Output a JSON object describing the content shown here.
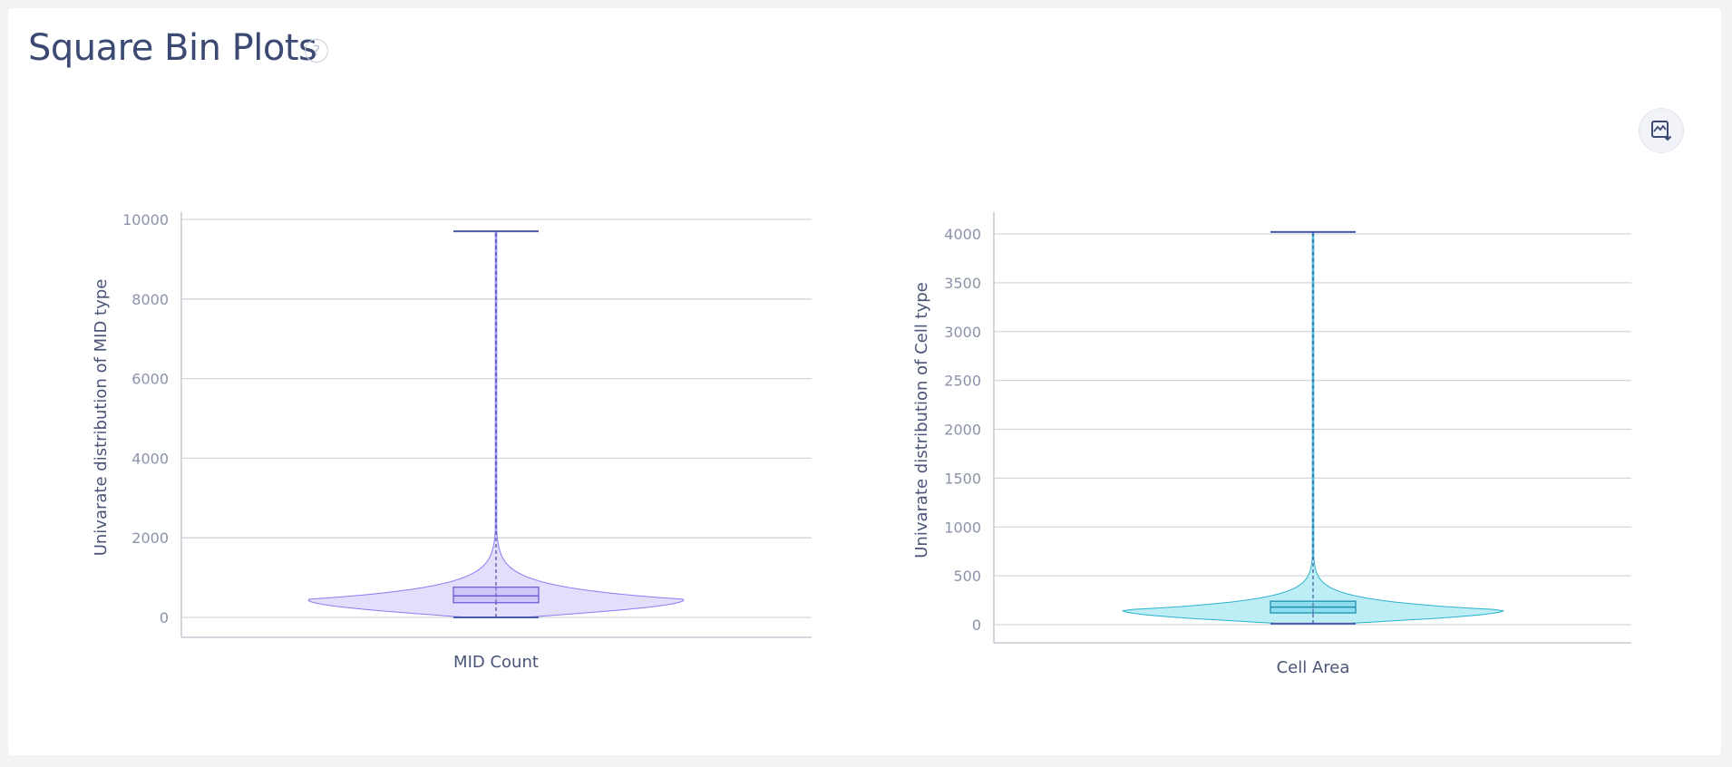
{
  "page": {
    "title": "Square Bin Plots",
    "help_glyph": "?",
    "export_icon": "image-download-icon"
  },
  "chart_data": [
    {
      "type": "violin",
      "title": "",
      "xlabel": "MID Count",
      "ylabel": "Univarate distribution of MID type",
      "ylim": [
        0,
        10000
      ],
      "ticks": [
        "0",
        "2000",
        "4000",
        "6000",
        "8000",
        "10000"
      ],
      "tick_values": [
        0,
        2000,
        4000,
        6000,
        8000,
        10000
      ],
      "grid": true,
      "color": "#8b7cf6",
      "fill": "#e4ddfb",
      "stats": {
        "min": 0,
        "q1": 370,
        "median": 540,
        "q3": 760,
        "max": 9700
      }
    },
    {
      "type": "violin",
      "title": "",
      "xlabel": "Cell Area",
      "ylabel": "Univarate distribution of Cell type",
      "ylim": [
        0,
        4000
      ],
      "ticks": [
        "0",
        "500",
        "1000",
        "1500",
        "2000",
        "2500",
        "3000",
        "3500",
        "4000"
      ],
      "tick_values": [
        0,
        500,
        1000,
        1500,
        2000,
        2500,
        3000,
        3500,
        4000
      ],
      "grid": true,
      "color": "#2ab3cf",
      "fill": "#bdeef5",
      "stats": {
        "min": 10,
        "q1": 120,
        "median": 180,
        "q3": 240,
        "max": 4020
      }
    }
  ]
}
